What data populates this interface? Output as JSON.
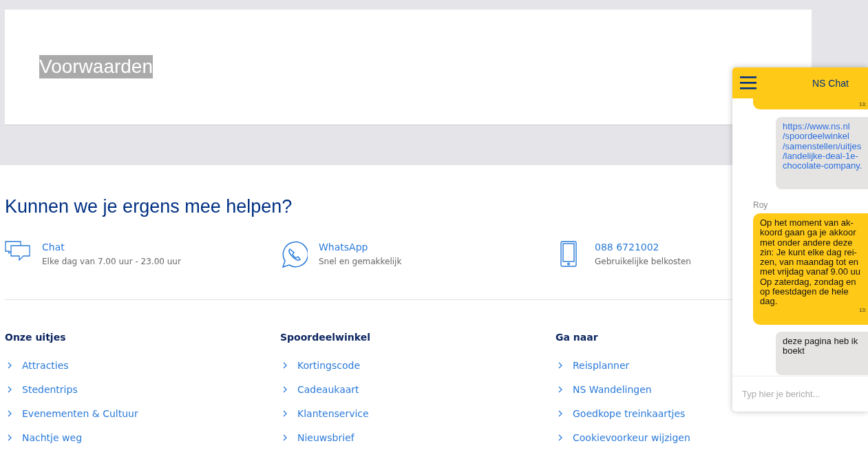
{
  "page": {
    "title": "Voorwaarden",
    "highlighted": true
  },
  "help": {
    "heading": "Kunnen we je ergens mee helpen?",
    "contacts": [
      {
        "kind": "chat",
        "label": "Chat",
        "detail": "Elke dag van 7.00 uur - 23.00 uur"
      },
      {
        "kind": "whatsapp",
        "label": "WhatsApp",
        "detail": "Snel en gemakkelijk"
      },
      {
        "kind": "phone",
        "label": "088 6721002",
        "detail": "Gebruikelijke belkosten"
      }
    ]
  },
  "footer": {
    "columns": [
      {
        "heading": "Onze uitjes",
        "links": [
          "Attracties",
          "Stedentrips",
          "Evenementen & Cultuur",
          "Nachtje weg"
        ]
      },
      {
        "heading": "Spoordeelwinkel",
        "links": [
          "Kortingscode",
          "Cadeaukaart",
          "Klantenservice",
          "Nieuwsbrief"
        ]
      },
      {
        "heading": "Ga naar",
        "links": [
          "Reisplanner",
          "NS Wandelingen",
          "Goedkope treinkaartjes",
          "Cookievoorkeur wijzigen"
        ]
      }
    ]
  },
  "chat": {
    "title": "NS Chat",
    "messages": [
      {
        "kind": "agent",
        "time": "13:"
      },
      {
        "kind": "user",
        "link": true,
        "text": "https://www.ns.nl\n/spoordeelwinkel\n/samenstellen/uitjes\n/landelijke-deal-1e-\nchocolate-company."
      },
      {
        "kind": "agent",
        "sender": "Roy",
        "text": "Op het moment van ak-\nkoord gaan ga je akkoor\nmet onder andere deze\nzin: Je kunt elke dag rei-\nzen, van maandag tot en\nmet vrijdag vanaf 9.00 uu\nOp zaterdag, zondag en\nop feestdagen de hele\ndag.",
        "time": "13:"
      },
      {
        "kind": "user",
        "link": false,
        "text": "deze pagina heb ik\nboekt"
      }
    ],
    "input": {
      "placeholder": "Typ hier je bericht..."
    }
  }
}
